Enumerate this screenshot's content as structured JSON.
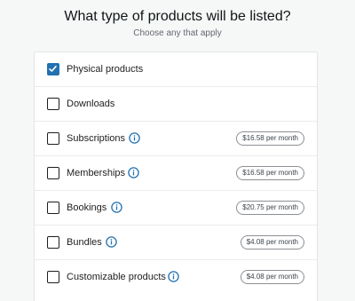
{
  "header": {
    "title": "What type of products will be listed?",
    "subtitle": "Choose any that apply"
  },
  "options": [
    {
      "label": "Physical products",
      "checked": true,
      "info": false,
      "price": ""
    },
    {
      "label": "Downloads",
      "checked": false,
      "info": false,
      "price": ""
    },
    {
      "label": "Subscriptions",
      "checked": false,
      "info": true,
      "price": "$16.58 per month"
    },
    {
      "label": "Memberships",
      "checked": false,
      "info": true,
      "price": "$16.58 per month"
    },
    {
      "label": "Bookings",
      "checked": false,
      "info": true,
      "price": "$20.75 per month"
    },
    {
      "label": "Bundles",
      "checked": false,
      "info": true,
      "price": "$4.08 per month"
    },
    {
      "label": "Customizable products",
      "checked": false,
      "info": true,
      "price": "$4.08 per month"
    }
  ],
  "colors": {
    "accent": "#2271b1",
    "info_icon": "#2271b1",
    "background": "#f6f7f7"
  },
  "icons": {
    "checkmark": "checkmark-icon",
    "info": "info-icon"
  }
}
